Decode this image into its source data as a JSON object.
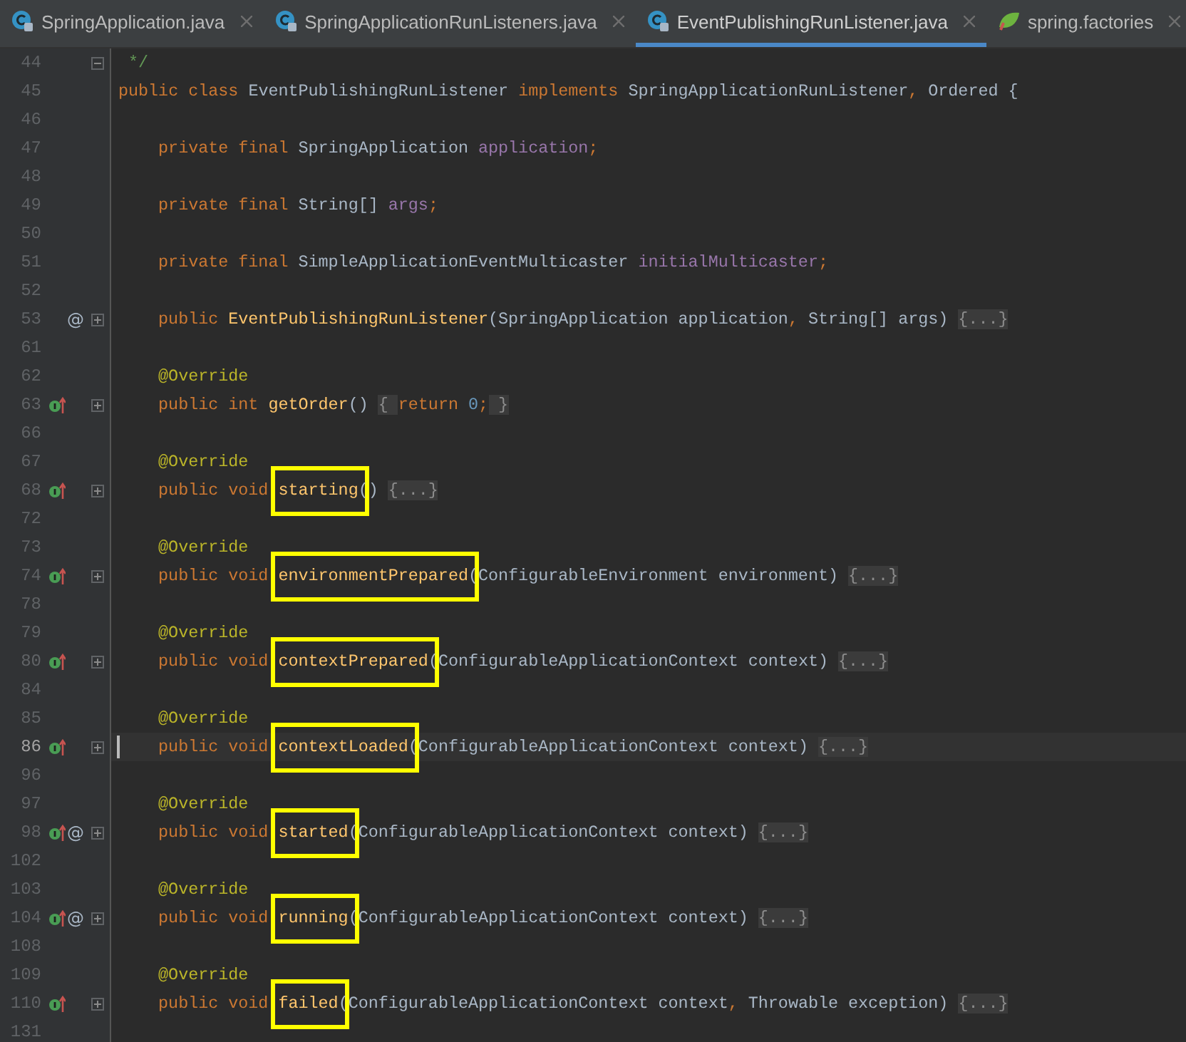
{
  "tabs": [
    {
      "label": "SpringApplication.java",
      "kind": "class",
      "selected": false
    },
    {
      "label": "SpringApplicationRunListeners.java",
      "kind": "class",
      "selected": false
    },
    {
      "label": "EventPublishingRunListener.java",
      "kind": "class",
      "selected": true
    },
    {
      "label": "spring.factories",
      "kind": "spring",
      "selected": false
    }
  ],
  "lines": [
    {
      "number": "44",
      "collapsed": false,
      "tokens": [
        {
          "kind": "comment",
          "text": " */"
        }
      ]
    },
    {
      "number": "45",
      "indented": false,
      "tokens": [
        {
          "kind": "kw",
          "text": "public class "
        },
        {
          "kind": "plain",
          "text": "EventPublishingRunListener "
        },
        {
          "kind": "kw",
          "text": "implements "
        },
        {
          "kind": "plain",
          "text": "SpringApplicationRunListener"
        },
        {
          "kind": "kw",
          "text": ","
        },
        {
          "kind": "plain",
          "text": " Ordered {"
        }
      ]
    },
    {
      "number": "46"
    },
    {
      "number": "47",
      "indented": true,
      "tokens": [
        {
          "kind": "kw",
          "text": "private final "
        },
        {
          "kind": "plain",
          "text": "SpringApplication "
        },
        {
          "kind": "field",
          "text": "application"
        },
        {
          "kind": "kw",
          "text": ";"
        }
      ]
    },
    {
      "number": "48"
    },
    {
      "number": "49",
      "indented": true,
      "tokens": [
        {
          "kind": "kw",
          "text": "private final "
        },
        {
          "kind": "plain",
          "text": "String[] "
        },
        {
          "kind": "field",
          "text": "args"
        },
        {
          "kind": "kw",
          "text": ";"
        }
      ]
    },
    {
      "number": "50"
    },
    {
      "number": "51",
      "indented": true,
      "tokens": [
        {
          "kind": "kw",
          "text": "private final "
        },
        {
          "kind": "plain",
          "text": "SimpleApplicationEventMulticaster "
        },
        {
          "kind": "field",
          "text": "initialMulticaster"
        },
        {
          "kind": "kw",
          "text": ";"
        }
      ]
    },
    {
      "number": "52"
    },
    {
      "number": "53",
      "indented": true,
      "collapsed": true,
      "at": "@",
      "tokens": [
        {
          "kind": "kw",
          "text": "public "
        },
        {
          "kind": "method",
          "text": "EventPublishingRunListener"
        },
        {
          "kind": "plain",
          "text": "(SpringApplication application"
        },
        {
          "kind": "kw",
          "text": ","
        },
        {
          "kind": "plain",
          "text": " String[] args) "
        },
        {
          "kind": "fold",
          "text": "{...}"
        }
      ]
    },
    {
      "number": "61"
    },
    {
      "number": "62",
      "indented": true,
      "tokens": [
        {
          "kind": "ann",
          "text": "@Override"
        }
      ]
    },
    {
      "number": "63",
      "indented": true,
      "collapsed": true,
      "gutter_icons": [
        {
          "kind": "implements"
        }
      ],
      "tokens": [
        {
          "kind": "kw",
          "text": "public int "
        },
        {
          "kind": "method",
          "text": "getOrder"
        },
        {
          "kind": "plain",
          "text": "() "
        },
        {
          "kind": "fold",
          "text": "{ "
        },
        {
          "kind": "kw",
          "text": "return "
        },
        {
          "kind": "num",
          "text": "0"
        },
        {
          "kind": "kw",
          "text": ";"
        },
        {
          "kind": "fold",
          "text": " }"
        }
      ]
    },
    {
      "number": "66"
    },
    {
      "number": "67",
      "indented": true,
      "tokens": [
        {
          "kind": "ann",
          "text": "@Override"
        }
      ]
    },
    {
      "number": "68",
      "indented": true,
      "collapsed": true,
      "gutter_icons": [
        {
          "kind": "implements"
        }
      ],
      "highlighted": true,
      "tokens": [
        {
          "kind": "kw",
          "text": "public void "
        },
        {
          "kind": "method",
          "text": "starting"
        },
        {
          "kind": "plain",
          "text": "() "
        },
        {
          "kind": "fold",
          "text": "{...}"
        }
      ]
    },
    {
      "number": "72"
    },
    {
      "number": "73",
      "indented": true,
      "tokens": [
        {
          "kind": "ann",
          "text": "@Override"
        }
      ]
    },
    {
      "number": "74",
      "indented": true,
      "collapsed": true,
      "gutter_icons": [
        {
          "kind": "implements"
        }
      ],
      "highlighted": true,
      "tokens": [
        {
          "kind": "kw",
          "text": "public void "
        },
        {
          "kind": "method",
          "text": "environmentPrepared"
        },
        {
          "kind": "plain",
          "text": "(ConfigurableEnvironment environment) "
        },
        {
          "kind": "fold",
          "text": "{...}"
        }
      ]
    },
    {
      "number": "78"
    },
    {
      "number": "79",
      "indented": true,
      "tokens": [
        {
          "kind": "ann",
          "text": "@Override"
        }
      ]
    },
    {
      "number": "80",
      "indented": true,
      "collapsed": true,
      "gutter_icons": [
        {
          "kind": "implements"
        }
      ],
      "highlighted": true,
      "tokens": [
        {
          "kind": "kw",
          "text": "public void "
        },
        {
          "kind": "method",
          "text": "contextPrepared"
        },
        {
          "kind": "plain",
          "text": "(ConfigurableApplicationContext context) "
        },
        {
          "kind": "fold",
          "text": "{...}"
        }
      ]
    },
    {
      "number": "84"
    },
    {
      "number": "85",
      "indented": true,
      "tokens": [
        {
          "kind": "ann",
          "text": "@Override"
        }
      ]
    },
    {
      "number": "86",
      "indented": true,
      "collapsed": true,
      "gutter_icons": [
        {
          "kind": "implements"
        }
      ],
      "highlighted": true,
      "current": true,
      "tokens": [
        {
          "kind": "kw",
          "text": "public void "
        },
        {
          "kind": "method",
          "text": "contextLoaded"
        },
        {
          "kind": "plain",
          "text": "(ConfigurableApplicationContext context) "
        },
        {
          "kind": "fold",
          "text": "{...}"
        }
      ]
    },
    {
      "number": "96"
    },
    {
      "number": "97",
      "indented": true,
      "tokens": [
        {
          "kind": "ann",
          "text": "@Override"
        }
      ]
    },
    {
      "number": "98",
      "indented": true,
      "collapsed": true,
      "gutter_icons": [
        {
          "kind": "implements"
        }
      ],
      "at": "@",
      "highlighted": true,
      "tokens": [
        {
          "kind": "kw",
          "text": "public void "
        },
        {
          "kind": "method",
          "text": "started"
        },
        {
          "kind": "plain",
          "text": "(ConfigurableApplicationContext context) "
        },
        {
          "kind": "fold",
          "text": "{...}"
        }
      ]
    },
    {
      "number": "102"
    },
    {
      "number": "103",
      "indented": true,
      "tokens": [
        {
          "kind": "ann",
          "text": "@Override"
        }
      ]
    },
    {
      "number": "104",
      "indented": true,
      "collapsed": true,
      "gutter_icons": [
        {
          "kind": "implements"
        }
      ],
      "at": "@",
      "highlighted": true,
      "tokens": [
        {
          "kind": "kw",
          "text": "public void "
        },
        {
          "kind": "method",
          "text": "running"
        },
        {
          "kind": "plain",
          "text": "(ConfigurableApplicationContext context) "
        },
        {
          "kind": "fold",
          "text": "{...}"
        }
      ]
    },
    {
      "number": "108"
    },
    {
      "number": "109",
      "indented": true,
      "tokens": [
        {
          "kind": "ann",
          "text": "@Override"
        }
      ]
    },
    {
      "number": "110",
      "indented": true,
      "collapsed": true,
      "gutter_icons": [
        {
          "kind": "implements"
        }
      ],
      "highlighted": true,
      "tokens": [
        {
          "kind": "kw",
          "text": "public void "
        },
        {
          "kind": "method",
          "text": "failed"
        },
        {
          "kind": "plain",
          "text": "(ConfigurableApplicationContext context"
        },
        {
          "kind": "kw",
          "text": ","
        },
        {
          "kind": "plain",
          "text": " Throwable exception) "
        },
        {
          "kind": "fold",
          "text": "{...}"
        }
      ]
    },
    {
      "number": "131"
    }
  ]
}
